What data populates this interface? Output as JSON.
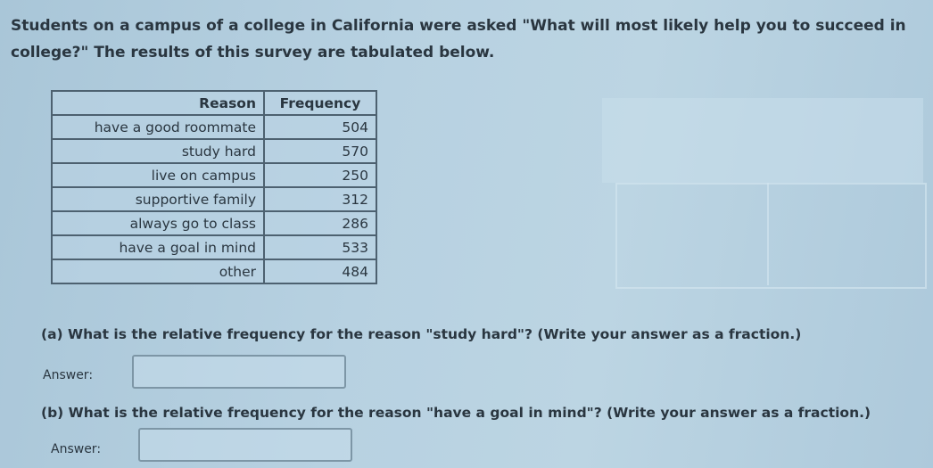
{
  "intro": "Students on a campus of a college in California were asked \"What will most likely help you to succeed in college?\" The results of this survey are tabulated below.",
  "table": {
    "headers": [
      "Reason",
      "Frequency"
    ],
    "rows": [
      {
        "reason": "have a good roommate",
        "frequency": "504"
      },
      {
        "reason": "study hard",
        "frequency": "570"
      },
      {
        "reason": "live on campus",
        "frequency": "250"
      },
      {
        "reason": "supportive family",
        "frequency": "312"
      },
      {
        "reason": "always go to class",
        "frequency": "286"
      },
      {
        "reason": "have a goal in mind",
        "frequency": "533"
      },
      {
        "reason": "other",
        "frequency": "484"
      }
    ]
  },
  "questions": [
    {
      "text": "(a) What is the relative frequency for the reason \"study hard\"? (Write your answer as a fraction.)",
      "answer_label": "Answer:",
      "answer_value": ""
    },
    {
      "text": "(b) What is the relative frequency for the reason \"have a goal in mind\"? (Write your answer as a fraction.)",
      "answer_label": "Answer:",
      "answer_value": ""
    }
  ]
}
